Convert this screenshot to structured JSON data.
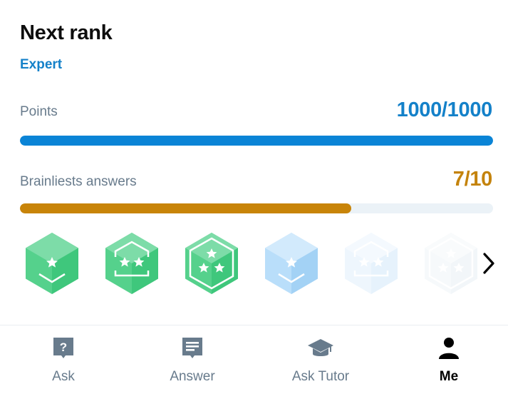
{
  "header": {
    "title": "Next rank",
    "rank_name": "Expert"
  },
  "points": {
    "label": "Points",
    "value_text": "1000/1000",
    "progress": 1.0,
    "color": "#0a84d6"
  },
  "brainliest": {
    "label": "Brainliests answers",
    "value_text": "7/10",
    "progress": 0.7,
    "color": "#c88409"
  },
  "badges": [
    {
      "icon": "one-star-green-badge-icon"
    },
    {
      "icon": "two-star-green-badge-icon"
    },
    {
      "icon": "three-star-green-badge-icon"
    },
    {
      "icon": "one-star-blue-badge-icon"
    },
    {
      "icon": "two-star-blue-faded-badge-icon"
    },
    {
      "icon": "three-star-faded-badge-icon"
    }
  ],
  "nav": {
    "items": [
      {
        "label": "Ask",
        "icon": "question-bubble-icon",
        "active": false
      },
      {
        "label": "Answer",
        "icon": "answer-bubble-icon",
        "active": false
      },
      {
        "label": "Ask Tutor",
        "icon": "graduation-cap-icon",
        "active": false
      },
      {
        "label": "Me",
        "icon": "person-icon",
        "active": true
      }
    ]
  }
}
